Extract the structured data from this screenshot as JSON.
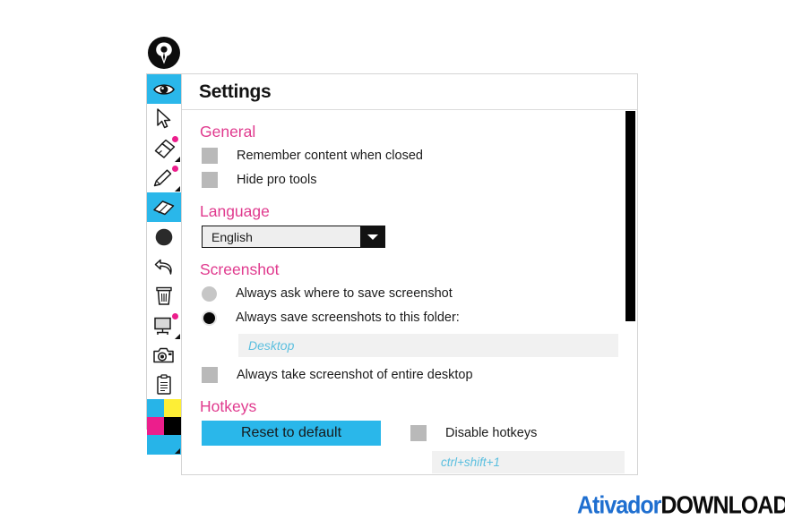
{
  "app": {
    "logo_icon": "pen-nib-circle-logo"
  },
  "toolbar": {
    "items": [
      {
        "icon": "eye-icon",
        "name": "tool-eye",
        "active": true,
        "pro": false
      },
      {
        "icon": "cursor-icon",
        "name": "tool-cursor",
        "active": false,
        "pro": false
      },
      {
        "icon": "marker-icon",
        "name": "tool-marker",
        "active": false,
        "pro": true
      },
      {
        "icon": "pencil-icon",
        "name": "tool-pencil",
        "active": false,
        "pro": true
      },
      {
        "icon": "eraser-icon",
        "name": "tool-eraser",
        "active": true,
        "pro": false
      },
      {
        "icon": "circle-icon",
        "name": "tool-shape",
        "active": false,
        "pro": false
      },
      {
        "icon": "undo-icon",
        "name": "tool-undo",
        "active": false,
        "pro": false
      },
      {
        "icon": "trash-icon",
        "name": "tool-clear",
        "active": false,
        "pro": false
      },
      {
        "icon": "whiteboard-icon",
        "name": "tool-whiteboard",
        "active": false,
        "pro": true
      },
      {
        "icon": "camera-icon",
        "name": "tool-screenshot",
        "active": false,
        "pro": false
      },
      {
        "icon": "clipboard-icon",
        "name": "tool-clipboard",
        "active": false,
        "pro": false
      }
    ],
    "color_swatch": {
      "name": "color-swatch",
      "cyan": "#27b4e8",
      "yellow": "#fdee36",
      "magenta": "#ec1e8c",
      "black": "#000000",
      "current": "#27b4e8"
    }
  },
  "settings": {
    "title": "Settings",
    "sections": {
      "general": {
        "heading": "General",
        "options": [
          {
            "label": "Remember content when closed",
            "checked": false
          },
          {
            "label": "Hide pro tools",
            "checked": false
          }
        ]
      },
      "language": {
        "heading": "Language",
        "selected": "English",
        "options": [
          "English"
        ]
      },
      "screenshot": {
        "heading": "Screenshot",
        "radios": [
          {
            "label": "Always ask where to save screenshot",
            "selected": false
          },
          {
            "label": "Always save screenshots to this folder:",
            "selected": true
          }
        ],
        "folder_value": "Desktop",
        "entire_desktop": {
          "label": "Always take screenshot of entire desktop",
          "checked": false
        }
      },
      "hotkeys": {
        "heading": "Hotkeys",
        "reset_label": "Reset to default",
        "disable_label": "Disable hotkeys",
        "disable_checked": false,
        "hotkey_value": "ctrl+shift+1"
      }
    }
  },
  "watermark": {
    "part_blue": "Ativador",
    "part_black": "DOWNLOADS.COM"
  },
  "colors": {
    "accent_pink": "#e03a8e",
    "accent_cyan": "#2ab7ea",
    "field_blue": "#5bbfdf"
  }
}
